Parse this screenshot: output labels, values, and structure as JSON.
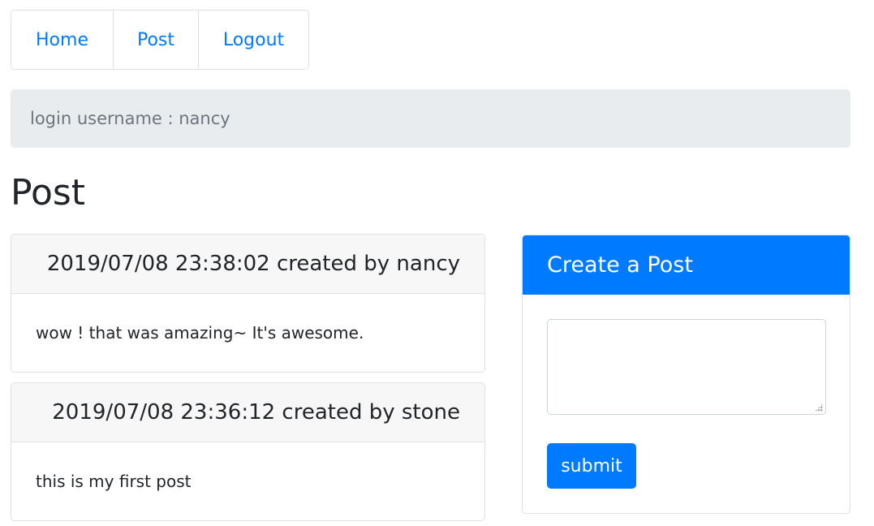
{
  "nav": {
    "items": [
      {
        "label": "Home"
      },
      {
        "label": "Post"
      },
      {
        "label": "Logout"
      }
    ]
  },
  "banner": {
    "text": "login username : nancy"
  },
  "page_title": "Post",
  "posts": [
    {
      "header": "2019/07/08 23:38:02 created by nancy",
      "body": "wow ! that was amazing~ It's awesome."
    },
    {
      "header": "2019/07/08 23:36:12 created by stone",
      "body": "this is my first post"
    }
  ],
  "create_post": {
    "title": "Create a Post",
    "textarea_value": "",
    "submit_label": "submit"
  },
  "colors": {
    "accent": "#007bff",
    "banner_bg": "#e9ecef",
    "card_header_bg": "#f7f7f7",
    "border": "#dee2e6"
  }
}
